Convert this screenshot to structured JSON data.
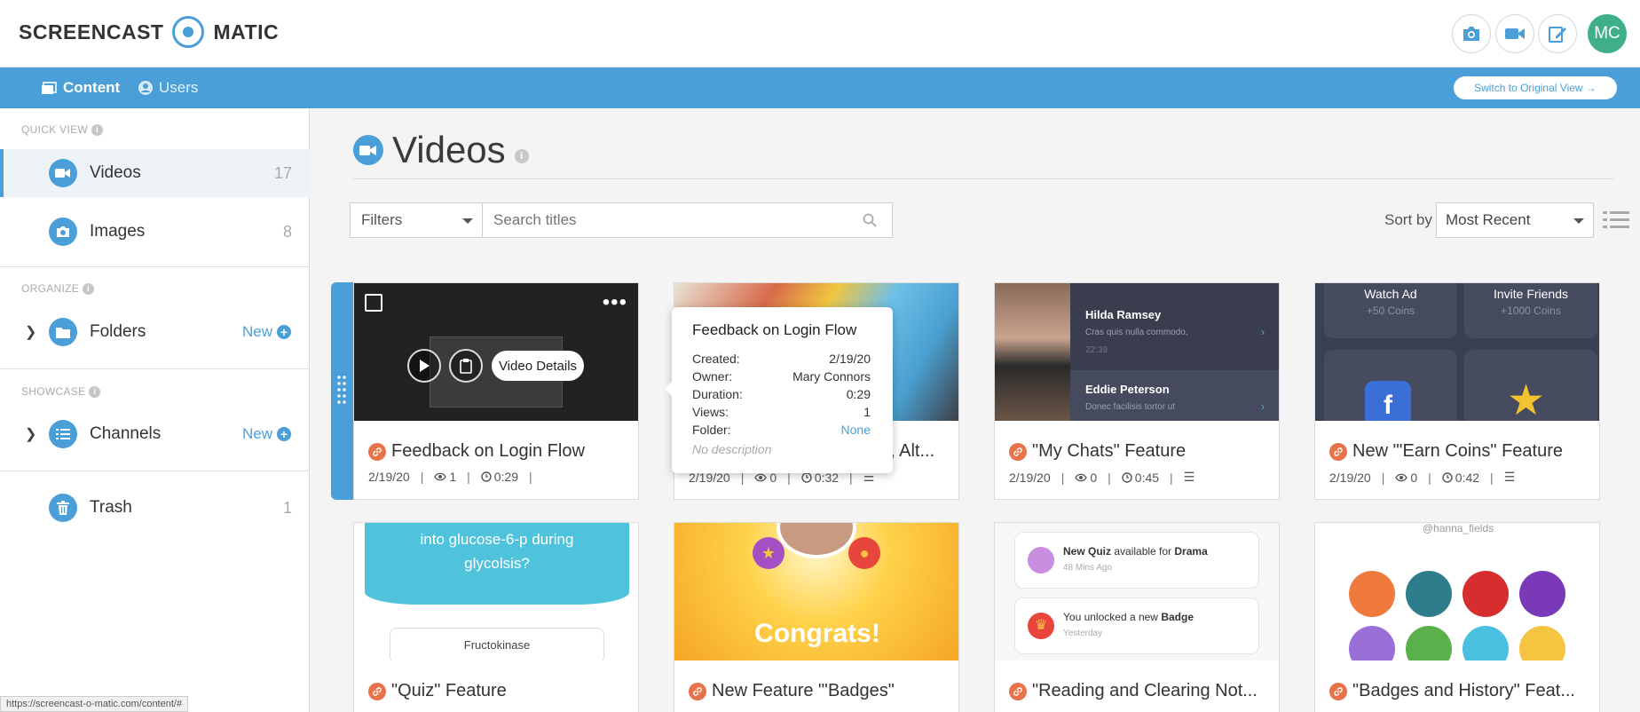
{
  "header": {
    "logo_left": "SCREENCAST",
    "logo_right": "MATIC",
    "buttons": [
      {
        "icon": "camera-icon"
      },
      {
        "icon": "video-camera-icon"
      },
      {
        "icon": "edit-icon"
      }
    ],
    "avatar_initials": "MC",
    "avatar_color": "#3fae8a"
  },
  "nav": {
    "content_label": "Content",
    "users_label": "Users",
    "switch_label": "Switch to Original View →"
  },
  "sidebar": {
    "quick_view_label": "QUICK VIEW",
    "organize_label": "ORGANIZE",
    "showcase_label": "SHOWCASE",
    "items": [
      {
        "label": "Videos",
        "count": "17",
        "icon": "video-camera-icon"
      },
      {
        "label": "Images",
        "count": "8",
        "icon": "camera-icon"
      },
      {
        "label": "Folders",
        "new_label": "New",
        "icon": "folder-icon"
      },
      {
        "label": "Channels",
        "new_label": "New",
        "icon": "list-icon"
      },
      {
        "label": "Trash",
        "count": "1",
        "icon": "trash-icon"
      }
    ]
  },
  "main": {
    "title": "Videos",
    "filters_label": "Filters",
    "search_placeholder": "Search titles",
    "sort_label": "Sort by",
    "sort_value": "Most Recent"
  },
  "cards": [
    {
      "title": "Feedback on Login Flow",
      "date": "2/19/20",
      "views": "1",
      "duration": "0:29",
      "video_details_label": "Video Details"
    },
    {
      "title": "e, Alt...",
      "date": "2/19/20",
      "views": "0",
      "duration": "0:32"
    },
    {
      "title": "\"My Chats\" Feature",
      "date": "2/19/20",
      "views": "0",
      "duration": "0:45",
      "thumb": {
        "name1": "Hilda Ramsey",
        "sub1": "Cras quis nulla commodo,",
        "time1": "22:39",
        "name2": "Eddie Peterson",
        "sub2": "Donec facilisis tortor ut"
      }
    },
    {
      "title": "New \"'Earn Coins\" Feature",
      "date": "2/19/20",
      "views": "0",
      "duration": "0:42",
      "thumb": {
        "a_title": "Watch Ad",
        "a_sub": "+50 Coins",
        "b_title": "Invite Friends",
        "b_sub": "+1000 Coins"
      }
    },
    {
      "title": "\"Quiz\" Feature",
      "thumb": {
        "question": "into glucose-6-p during glycolsis?",
        "answer": "Fructokinase"
      }
    },
    {
      "title": "New Feature \"'Badges\"",
      "thumb": {
        "banner": "Congrats!"
      }
    },
    {
      "title": "\"Reading and Clearing Not...",
      "thumb": {
        "n1_pre": "New Quiz",
        "n1_mid": " available for ",
        "n1_bold": "Drama",
        "n1_time": "48 Mins Ago",
        "n2_pre": "You unlocked a new ",
        "n2_bold": "Badge",
        "n2_time": "Yesterday"
      }
    },
    {
      "title": "\"Badges and History\" Feat...",
      "thumb": {
        "handle": "@hanna_fields"
      }
    }
  ],
  "tooltip": {
    "title": "Feedback on Login Flow",
    "rows": [
      {
        "k": "Created:",
        "v": "2/19/20"
      },
      {
        "k": "Owner:",
        "v": "Mary Connors"
      },
      {
        "k": "Duration:",
        "v": "0:29"
      },
      {
        "k": "Views:",
        "v": "1"
      },
      {
        "k": "Folder:",
        "v": "None"
      }
    ],
    "description": "No description"
  },
  "status_url": "https://screencast-o-matic.com/content/#",
  "colors": {
    "accent": "#4a9fd8",
    "link_badge": "#e8734a"
  }
}
